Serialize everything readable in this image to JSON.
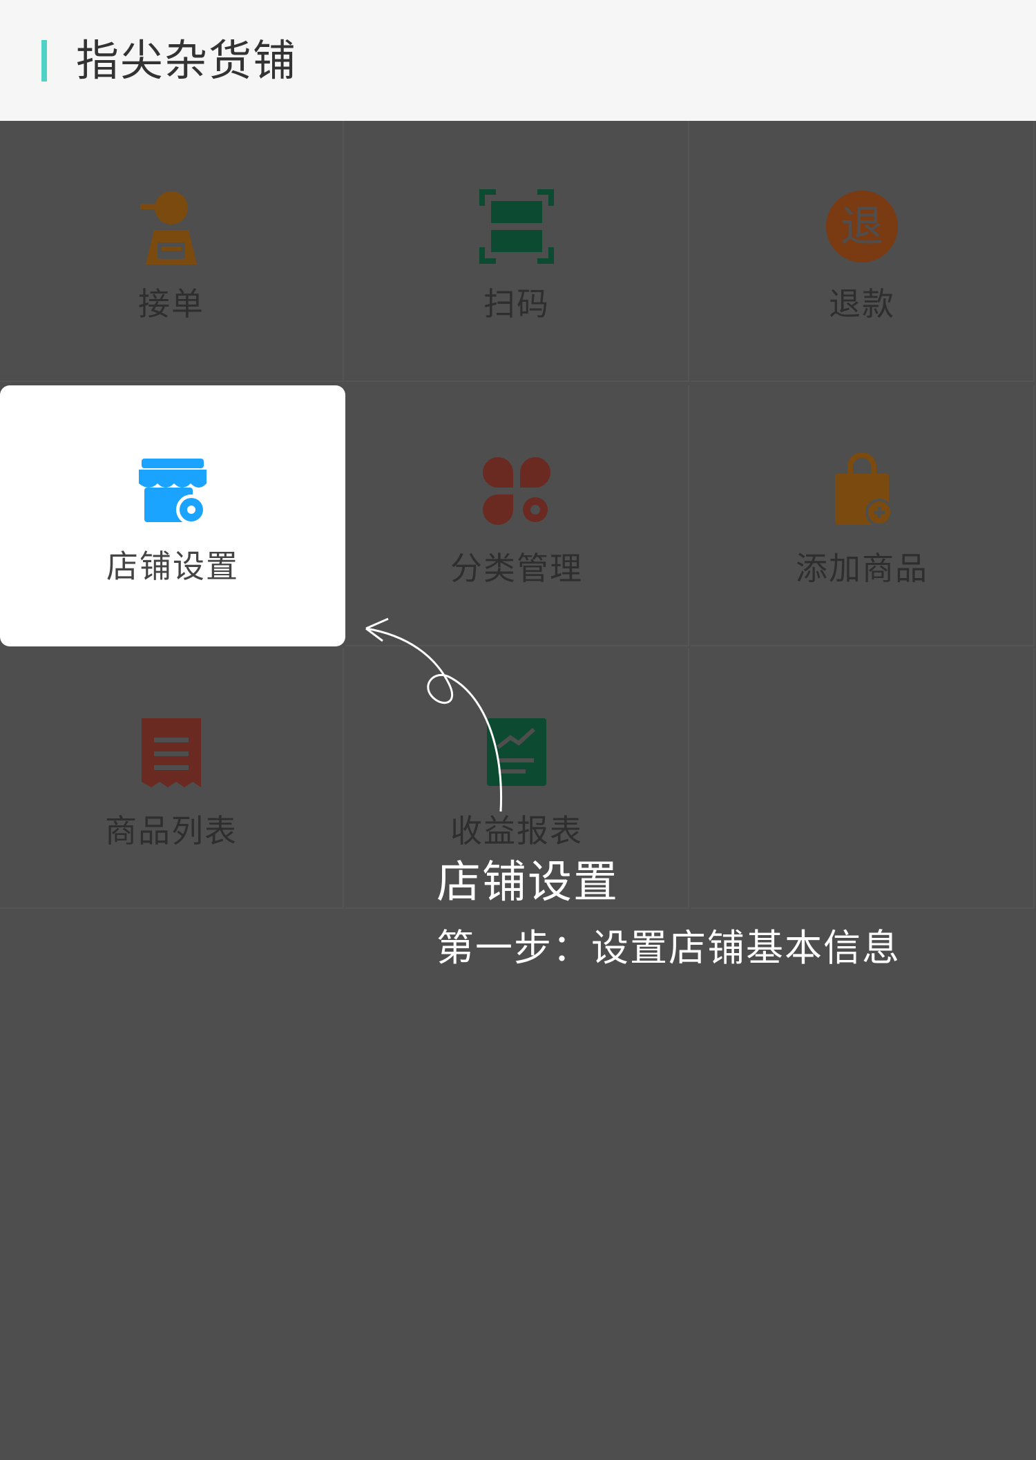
{
  "header": {
    "title": "指尖杂货铺",
    "accent_color": "#4fd1c5"
  },
  "menu": {
    "items": [
      {
        "label": "接单",
        "icon": "order-person-icon",
        "color": "#7a4a0f"
      },
      {
        "label": "扫码",
        "icon": "scan-icon",
        "color": "#0d4a32"
      },
      {
        "label": "退款",
        "icon": "refund-icon",
        "color": "#7a3a12",
        "glyph": "退"
      },
      {
        "label": "店铺设置",
        "icon": "store-settings-icon",
        "color": "#1aa3ff"
      },
      {
        "label": "分类管理",
        "icon": "category-icon",
        "color": "#6a2a22"
      },
      {
        "label": "添加商品",
        "icon": "add-product-icon",
        "color": "#7a4a0f"
      },
      {
        "label": "商品列表",
        "icon": "product-list-icon",
        "color": "#6a2a22"
      },
      {
        "label": "收益报表",
        "icon": "report-icon",
        "color": "#0d4a32"
      }
    ]
  },
  "guide": {
    "title": "店铺设置",
    "description": "第一步：设置店铺基本信息",
    "overlay_color": "#4e4e4e"
  }
}
